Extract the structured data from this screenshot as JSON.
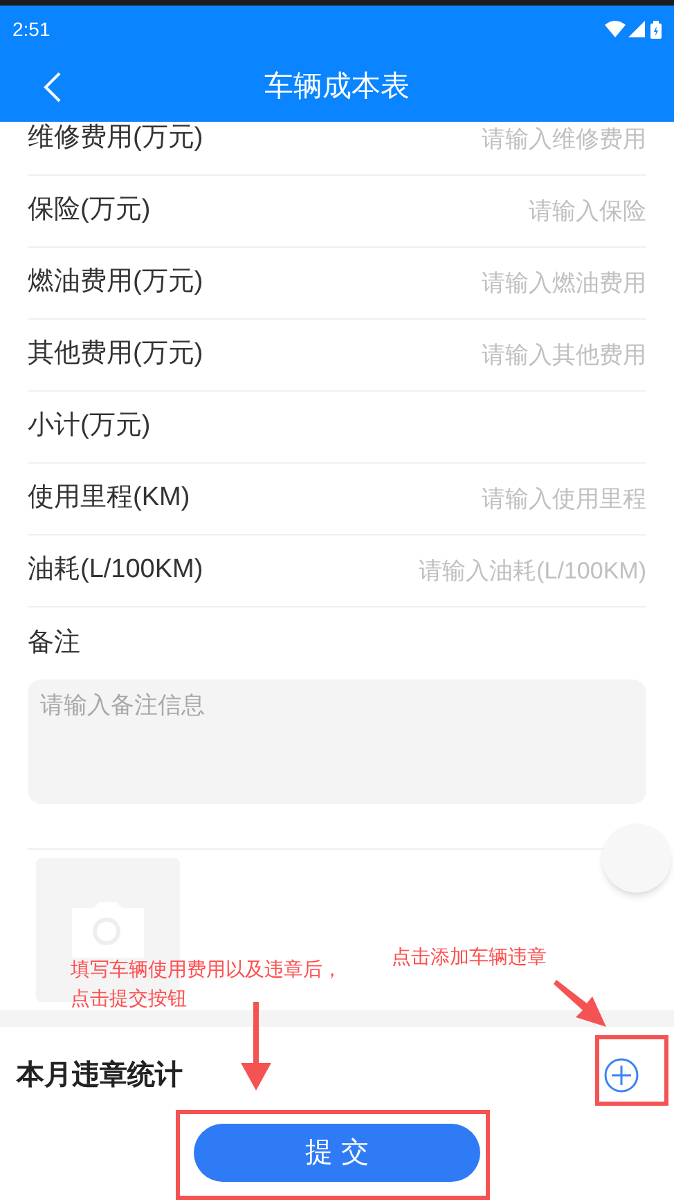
{
  "status_bar": {
    "time": "2:51"
  },
  "header": {
    "title": "车辆成本表"
  },
  "fields": [
    {
      "kind": "input",
      "label": "维修费用(万元)",
      "placeholder": "请输入维修费用"
    },
    {
      "kind": "input",
      "label": "保险(万元)",
      "placeholder": "请输入保险"
    },
    {
      "kind": "input",
      "label": "燃油费用(万元)",
      "placeholder": "请输入燃油费用"
    },
    {
      "kind": "input",
      "label": "其他费用(万元)",
      "placeholder": "请输入其他费用"
    },
    {
      "kind": "readonly",
      "label": "小计(万元)"
    },
    {
      "kind": "input",
      "label": "使用里程(KM)",
      "placeholder": "请输入使用里程"
    },
    {
      "kind": "input",
      "label": "油耗(L/100KM)",
      "placeholder": "请输入油耗(L/100KM)"
    },
    {
      "kind": "textarea",
      "label": "备注",
      "placeholder": "请输入备注信息"
    }
  ],
  "violations": {
    "title": "本月违章统计"
  },
  "submit": {
    "label": "提 交"
  },
  "annotations": [
    {
      "text": "填写车辆使用费用以及违章后，"
    },
    {
      "text": "点击提交按钮"
    },
    {
      "text": "点击添加车辆违章"
    }
  ]
}
